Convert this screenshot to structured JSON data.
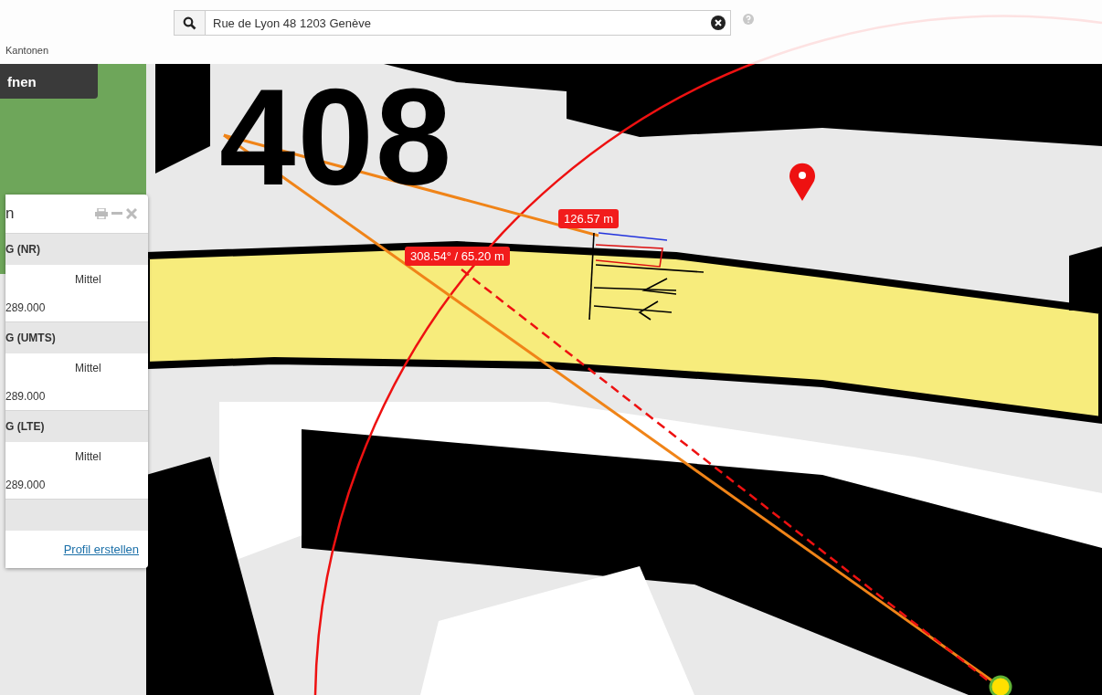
{
  "search": {
    "value": "Rue de Lyon 48 1203 Genève"
  },
  "layer_label": "Kantonen",
  "open_button": {
    "label": "fnen"
  },
  "map": {
    "street_number": "408",
    "measurements": [
      {
        "text": "126.57 m"
      },
      {
        "text": "308.54° / 65.20 m"
      }
    ]
  },
  "panel": {
    "title": "n",
    "sections": [
      {
        "title": "G (NR)",
        "rating": "Mittel",
        "value": "289.000"
      },
      {
        "title": "G (UMTS)",
        "rating": "Mittel",
        "value": "289.000"
      },
      {
        "title": "G (LTE)",
        "rating": "Mittel",
        "value": "289.000"
      }
    ],
    "link": "Profil erstellen"
  }
}
